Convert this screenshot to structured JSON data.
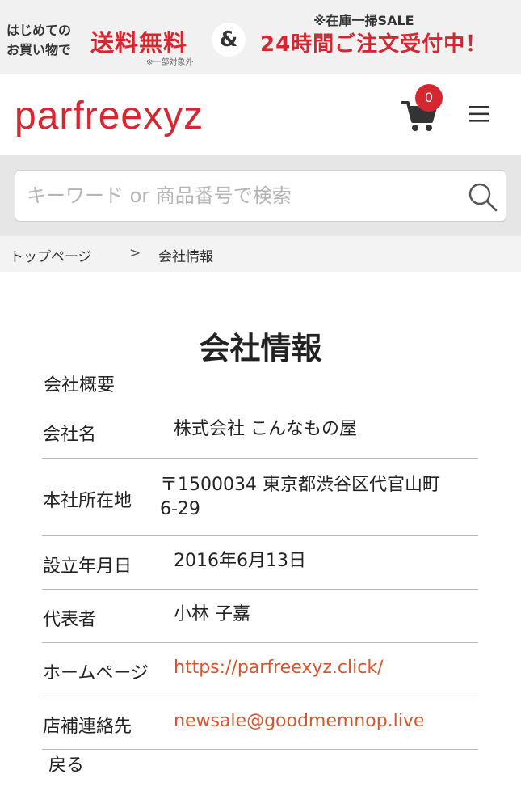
{
  "promo": {
    "first_time_line1": "はじめての",
    "first_time_line2": "お買い物で",
    "free_shipping": "送料無料",
    "free_shipping_note": "※一部対象外",
    "ampersand": "&",
    "sale_note": "※在庫一掃SALE",
    "orders_24h": "24時間ご注文受付中！"
  },
  "header": {
    "logo": "parfreexyz",
    "cart_count": "0"
  },
  "search": {
    "placeholder": "キーワード or 商品番号で検索"
  },
  "breadcrumb": {
    "home": "トップページ",
    "separator": ">",
    "current": "会社情報"
  },
  "page": {
    "title": "会社情報",
    "section_title": "会社概要",
    "rows": [
      {
        "label": "会社名",
        "value": "株式会社 こんなもの屋"
      },
      {
        "label": "本社所在地",
        "value_line1": "〒1500034 東京都渋谷区代官山町",
        "value_line2": "6-29"
      },
      {
        "label": "設立年月日",
        "value": "2016年6月13日"
      },
      {
        "label": "代表者",
        "value": "小林 子嘉"
      },
      {
        "label": "ホームページ",
        "value": "https://parfreexyz.click/"
      },
      {
        "label": "店補連絡先",
        "value": "newsale@goodmemnop.live"
      }
    ],
    "back_label": "戻る"
  },
  "colors": {
    "brand_red": "#d6262f",
    "link_orange": "#d9542b"
  }
}
